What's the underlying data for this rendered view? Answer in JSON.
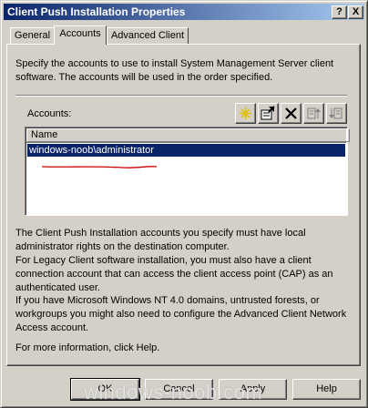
{
  "window": {
    "title": "Client Push Installation Properties",
    "help_glyph": "?",
    "close_glyph": "X"
  },
  "tabs": [
    {
      "label": "General"
    },
    {
      "label": "Accounts",
      "active": true
    },
    {
      "label": "Advanced Client"
    }
  ],
  "accounts_tab": {
    "intro": "Specify the accounts to use to install System Management Server client software. The accounts will be used in the order specified.",
    "accounts_label": "Accounts:",
    "toolbar": [
      {
        "icon": "new-star-icon"
      },
      {
        "icon": "properties-icon"
      },
      {
        "icon": "delete-x-icon"
      },
      {
        "icon": "move-up-icon"
      },
      {
        "icon": "move-down-icon"
      }
    ],
    "list": {
      "column_header": "Name",
      "rows": [
        "windows-noob\\administrator"
      ]
    },
    "note1": "The Client Push Installation accounts you specify must have local administrator rights on the destination computer.",
    "note2": "For Legacy Client software installation, you must also have a client connection account that can access the client access point (CAP) as an authenticated user.",
    "note3": "If you have Microsoft Windows NT 4.0 domains, untrusted forests, or workgroups you might also need to configure the Advanced Client Network Access account.",
    "note4": "For more information, click Help."
  },
  "buttons": {
    "ok": "OK",
    "cancel": "Cancel",
    "apply": "Apply",
    "help": "Help"
  },
  "watermark": "windows-noob.com",
  "colors": {
    "titlebar_start": "#0a246a",
    "titlebar_end": "#a6caf0",
    "selection": "#0a246a",
    "annotation_red": "#cc0000"
  }
}
